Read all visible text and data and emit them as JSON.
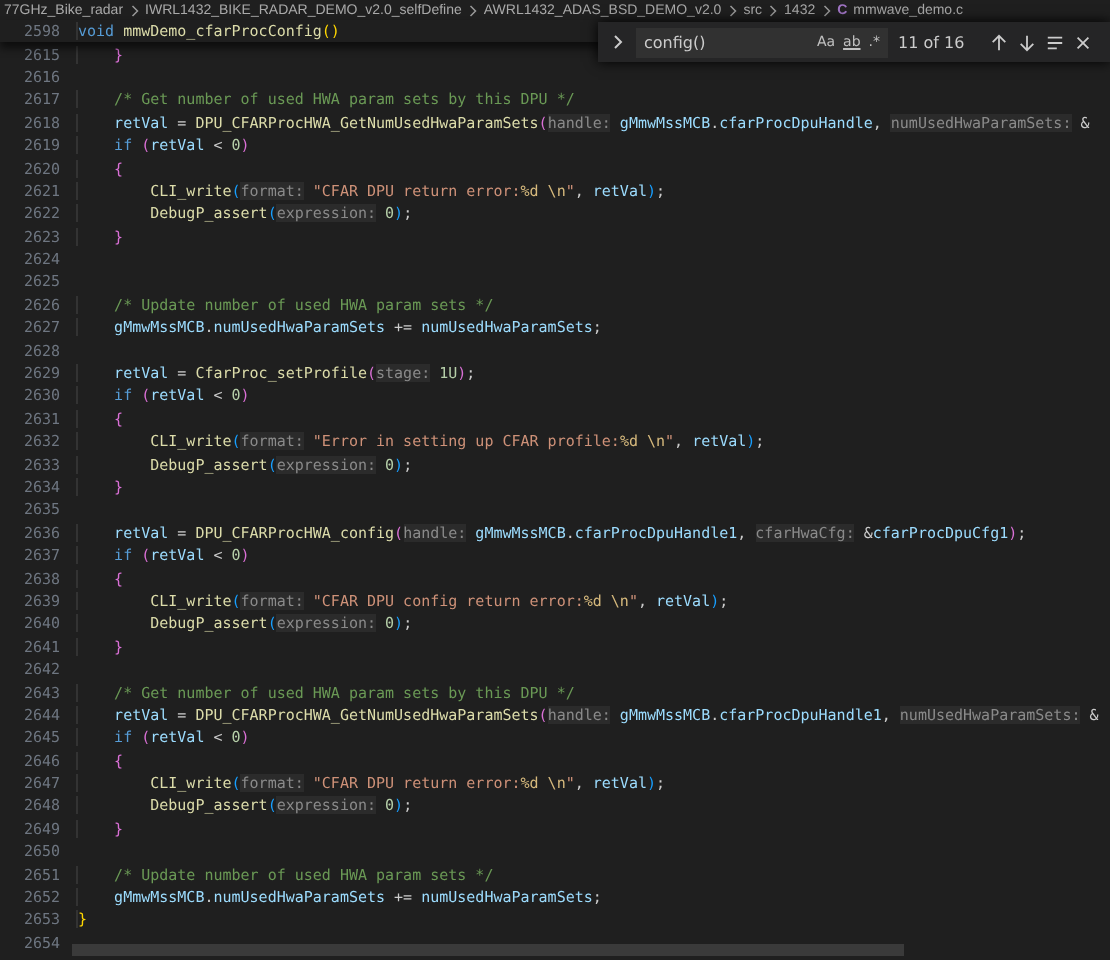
{
  "breadcrumbs": [
    {
      "text": "77GHz_Bike_radar"
    },
    {
      "text": "IWRL1432_BIKE_RADAR_DEMO_v2.0_selfDefine"
    },
    {
      "text": "AWRL1432_ADAS_BSD_DEMO_v2.0"
    },
    {
      "text": "src"
    },
    {
      "text": "1432"
    },
    {
      "text": "mmwave_demo.c",
      "icon": "C"
    }
  ],
  "sticky_line": {
    "number": "2598",
    "tokens": [
      {
        "kind": "kw",
        "text": "void "
      },
      {
        "kind": "fn",
        "text": "mmwDemo_cfarProcConfig"
      },
      {
        "kind": "b1",
        "text": "()"
      }
    ]
  },
  "find_widget": {
    "query": "config()",
    "options": [
      {
        "label": "Aa",
        "selected": false
      },
      {
        "label": "ab",
        "selected": false
      },
      {
        "label": ".*",
        "selected": false
      }
    ],
    "result": "11 of 16"
  },
  "lines": [
    {
      "number": "2615",
      "tokens": [
        {
          "kind": "b2",
          "text": "    }"
        }
      ]
    },
    {
      "number": "2616"
    },
    {
      "number": "2617",
      "tokens": [
        {
          "kind": "com",
          "text": "    /* Get number of used HWA param sets by this DPU */"
        }
      ]
    },
    {
      "number": "2618",
      "tokens": [
        {
          "kind": "var",
          "text": "    retVal"
        },
        {
          "kind": "pl",
          "text": " = "
        },
        {
          "kind": "fn",
          "text": "DPU_CFARProcHWA_GetNumUsedHwaParamSets"
        },
        {
          "kind": "b2",
          "text": "("
        },
        {
          "kind": "hint",
          "text": "handle:"
        },
        {
          "kind": "var",
          "text": " gMmwMssMCB"
        },
        {
          "kind": "pl",
          "text": "."
        },
        {
          "kind": "var",
          "text": "cfarProcDpuHandle"
        },
        {
          "kind": "pl",
          "text": ", "
        },
        {
          "kind": "hint",
          "text": "numUsedHwaParamSets:"
        },
        {
          "kind": "pl",
          "text": " &"
        }
      ]
    },
    {
      "number": "2619",
      "tokens": [
        {
          "kind": "kw",
          "text": "    if "
        },
        {
          "kind": "b2",
          "text": "("
        },
        {
          "kind": "var",
          "text": "retVal"
        },
        {
          "kind": "pl",
          "text": " < "
        },
        {
          "kind": "num",
          "text": "0"
        },
        {
          "kind": "b2",
          "text": ")"
        }
      ]
    },
    {
      "number": "2620",
      "tokens": [
        {
          "kind": "b2",
          "text": "    {"
        }
      ]
    },
    {
      "number": "2621",
      "tokens": [
        {
          "kind": "fn",
          "text": "        CLI_write"
        },
        {
          "kind": "b3",
          "text": "("
        },
        {
          "kind": "hint",
          "text": "format:"
        },
        {
          "kind": "str",
          "text": " \"CFAR DPU return error:"
        },
        {
          "kind": "esc",
          "text": "%d \\n"
        },
        {
          "kind": "str",
          "text": "\""
        },
        {
          "kind": "pl",
          "text": ", "
        },
        {
          "kind": "var",
          "text": "retVal"
        },
        {
          "kind": "b3",
          "text": ")"
        },
        {
          "kind": "pl",
          "text": ";"
        }
      ]
    },
    {
      "number": "2622",
      "tokens": [
        {
          "kind": "fn",
          "text": "        DebugP_assert"
        },
        {
          "kind": "b3",
          "text": "("
        },
        {
          "kind": "hint",
          "text": "expression:"
        },
        {
          "kind": "num",
          "text": " 0"
        },
        {
          "kind": "b3",
          "text": ")"
        },
        {
          "kind": "pl",
          "text": ";"
        }
      ]
    },
    {
      "number": "2623",
      "tokens": [
        {
          "kind": "b2",
          "text": "    }"
        }
      ]
    },
    {
      "number": "2624"
    },
    {
      "number": "2625"
    },
    {
      "number": "2626",
      "tokens": [
        {
          "kind": "com",
          "text": "    /* Update number of used HWA param sets */"
        }
      ]
    },
    {
      "number": "2627",
      "tokens": [
        {
          "kind": "var",
          "text": "    gMmwMssMCB"
        },
        {
          "kind": "pl",
          "text": "."
        },
        {
          "kind": "var",
          "text": "numUsedHwaParamSets"
        },
        {
          "kind": "pl",
          "text": " += "
        },
        {
          "kind": "var",
          "text": "numUsedHwaParamSets"
        },
        {
          "kind": "pl",
          "text": ";"
        }
      ]
    },
    {
      "number": "2628"
    },
    {
      "number": "2629",
      "tokens": [
        {
          "kind": "var",
          "text": "    retVal"
        },
        {
          "kind": "pl",
          "text": " = "
        },
        {
          "kind": "fn",
          "text": "CfarProc_setProfile"
        },
        {
          "kind": "b2",
          "text": "("
        },
        {
          "kind": "hint",
          "text": "stage:"
        },
        {
          "kind": "num",
          "text": " 1U"
        },
        {
          "kind": "b2",
          "text": ")"
        },
        {
          "kind": "pl",
          "text": ";"
        }
      ]
    },
    {
      "number": "2630",
      "tokens": [
        {
          "kind": "kw",
          "text": "    if "
        },
        {
          "kind": "b2",
          "text": "("
        },
        {
          "kind": "var",
          "text": "retVal"
        },
        {
          "kind": "pl",
          "text": " < "
        },
        {
          "kind": "num",
          "text": "0"
        },
        {
          "kind": "b2",
          "text": ")"
        }
      ]
    },
    {
      "number": "2631",
      "tokens": [
        {
          "kind": "b2",
          "text": "    {"
        }
      ]
    },
    {
      "number": "2632",
      "tokens": [
        {
          "kind": "fn",
          "text": "        CLI_write"
        },
        {
          "kind": "b3",
          "text": "("
        },
        {
          "kind": "hint",
          "text": "format:"
        },
        {
          "kind": "str",
          "text": " \"Error in setting up CFAR profile:"
        },
        {
          "kind": "esc",
          "text": "%d \\n"
        },
        {
          "kind": "str",
          "text": "\""
        },
        {
          "kind": "pl",
          "text": ", "
        },
        {
          "kind": "var",
          "text": "retVal"
        },
        {
          "kind": "b3",
          "text": ")"
        },
        {
          "kind": "pl",
          "text": ";"
        }
      ]
    },
    {
      "number": "2633",
      "tokens": [
        {
          "kind": "fn",
          "text": "        DebugP_assert"
        },
        {
          "kind": "b3",
          "text": "("
        },
        {
          "kind": "hint",
          "text": "expression:"
        },
        {
          "kind": "num",
          "text": " 0"
        },
        {
          "kind": "b3",
          "text": ")"
        },
        {
          "kind": "pl",
          "text": ";"
        }
      ]
    },
    {
      "number": "2634",
      "tokens": [
        {
          "kind": "b2",
          "text": "    }"
        }
      ]
    },
    {
      "number": "2635"
    },
    {
      "number": "2636",
      "tokens": [
        {
          "kind": "var",
          "text": "    retVal"
        },
        {
          "kind": "pl",
          "text": " = "
        },
        {
          "kind": "fn",
          "text": "DPU_CFARProcHWA_config"
        },
        {
          "kind": "b2",
          "text": "("
        },
        {
          "kind": "hint",
          "text": "handle:"
        },
        {
          "kind": "var",
          "text": " gMmwMssMCB"
        },
        {
          "kind": "pl",
          "text": "."
        },
        {
          "kind": "var",
          "text": "cfarProcDpuHandle1"
        },
        {
          "kind": "pl",
          "text": ", "
        },
        {
          "kind": "hint",
          "text": "cfarHwaCfg:"
        },
        {
          "kind": "pl",
          "text": " &"
        },
        {
          "kind": "var",
          "text": "cfarProcDpuCfg1"
        },
        {
          "kind": "b2",
          "text": ")"
        },
        {
          "kind": "pl",
          "text": ";"
        }
      ]
    },
    {
      "number": "2637",
      "tokens": [
        {
          "kind": "kw",
          "text": "    if "
        },
        {
          "kind": "b2",
          "text": "("
        },
        {
          "kind": "var",
          "text": "retVal"
        },
        {
          "kind": "pl",
          "text": " < "
        },
        {
          "kind": "num",
          "text": "0"
        },
        {
          "kind": "b2",
          "text": ")"
        }
      ]
    },
    {
      "number": "2638",
      "tokens": [
        {
          "kind": "b2",
          "text": "    {"
        }
      ]
    },
    {
      "number": "2639",
      "tokens": [
        {
          "kind": "fn",
          "text": "        CLI_write"
        },
        {
          "kind": "b3",
          "text": "("
        },
        {
          "kind": "hint",
          "text": "format:"
        },
        {
          "kind": "str",
          "text": " \"CFAR DPU config return error:"
        },
        {
          "kind": "esc",
          "text": "%d \\n"
        },
        {
          "kind": "str",
          "text": "\""
        },
        {
          "kind": "pl",
          "text": ", "
        },
        {
          "kind": "var",
          "text": "retVal"
        },
        {
          "kind": "b3",
          "text": ")"
        },
        {
          "kind": "pl",
          "text": ";"
        }
      ]
    },
    {
      "number": "2640",
      "tokens": [
        {
          "kind": "fn",
          "text": "        DebugP_assert"
        },
        {
          "kind": "b3",
          "text": "("
        },
        {
          "kind": "hint",
          "text": "expression:"
        },
        {
          "kind": "num",
          "text": " 0"
        },
        {
          "kind": "b3",
          "text": ")"
        },
        {
          "kind": "pl",
          "text": ";"
        }
      ]
    },
    {
      "number": "2641",
      "tokens": [
        {
          "kind": "b2",
          "text": "    }"
        }
      ]
    },
    {
      "number": "2642"
    },
    {
      "number": "2643",
      "tokens": [
        {
          "kind": "com",
          "text": "    /* Get number of used HWA param sets by this DPU */"
        }
      ]
    },
    {
      "number": "2644",
      "tokens": [
        {
          "kind": "var",
          "text": "    retVal"
        },
        {
          "kind": "pl",
          "text": " = "
        },
        {
          "kind": "fn",
          "text": "DPU_CFARProcHWA_GetNumUsedHwaParamSets"
        },
        {
          "kind": "b2",
          "text": "("
        },
        {
          "kind": "hint",
          "text": "handle:"
        },
        {
          "kind": "var",
          "text": " gMmwMssMCB"
        },
        {
          "kind": "pl",
          "text": "."
        },
        {
          "kind": "var",
          "text": "cfarProcDpuHandle1"
        },
        {
          "kind": "pl",
          "text": ", "
        },
        {
          "kind": "hint",
          "text": "numUsedHwaParamSets:"
        },
        {
          "kind": "pl",
          "text": " &"
        }
      ]
    },
    {
      "number": "2645",
      "tokens": [
        {
          "kind": "kw",
          "text": "    if "
        },
        {
          "kind": "b2",
          "text": "("
        },
        {
          "kind": "var",
          "text": "retVal"
        },
        {
          "kind": "pl",
          "text": " < "
        },
        {
          "kind": "num",
          "text": "0"
        },
        {
          "kind": "b2",
          "text": ")"
        }
      ]
    },
    {
      "number": "2646",
      "tokens": [
        {
          "kind": "b2",
          "text": "    {"
        }
      ]
    },
    {
      "number": "2647",
      "tokens": [
        {
          "kind": "fn",
          "text": "        CLI_write"
        },
        {
          "kind": "b3",
          "text": "("
        },
        {
          "kind": "hint",
          "text": "format:"
        },
        {
          "kind": "str",
          "text": " \"CFAR DPU return error:"
        },
        {
          "kind": "esc",
          "text": "%d \\n"
        },
        {
          "kind": "str",
          "text": "\""
        },
        {
          "kind": "pl",
          "text": ", "
        },
        {
          "kind": "var",
          "text": "retVal"
        },
        {
          "kind": "b3",
          "text": ")"
        },
        {
          "kind": "pl",
          "text": ";"
        }
      ]
    },
    {
      "number": "2648",
      "tokens": [
        {
          "kind": "fn",
          "text": "        DebugP_assert"
        },
        {
          "kind": "b3",
          "text": "("
        },
        {
          "kind": "hint",
          "text": "expression:"
        },
        {
          "kind": "num",
          "text": " 0"
        },
        {
          "kind": "b3",
          "text": ")"
        },
        {
          "kind": "pl",
          "text": ";"
        }
      ]
    },
    {
      "number": "2649",
      "tokens": [
        {
          "kind": "b2",
          "text": "    }"
        }
      ]
    },
    {
      "number": "2650"
    },
    {
      "number": "2651",
      "tokens": [
        {
          "kind": "com",
          "text": "    /* Update number of used HWA param sets */"
        }
      ]
    },
    {
      "number": "2652",
      "tokens": [
        {
          "kind": "var",
          "text": "    gMmwMssMCB"
        },
        {
          "kind": "pl",
          "text": "."
        },
        {
          "kind": "var",
          "text": "numUsedHwaParamSets"
        },
        {
          "kind": "pl",
          "text": " += "
        },
        {
          "kind": "var",
          "text": "numUsedHwaParamSets"
        },
        {
          "kind": "pl",
          "text": ";"
        }
      ]
    },
    {
      "number": "2653",
      "tokens": [
        {
          "kind": "b1",
          "text": "}"
        }
      ]
    },
    {
      "number": "2654"
    }
  ]
}
